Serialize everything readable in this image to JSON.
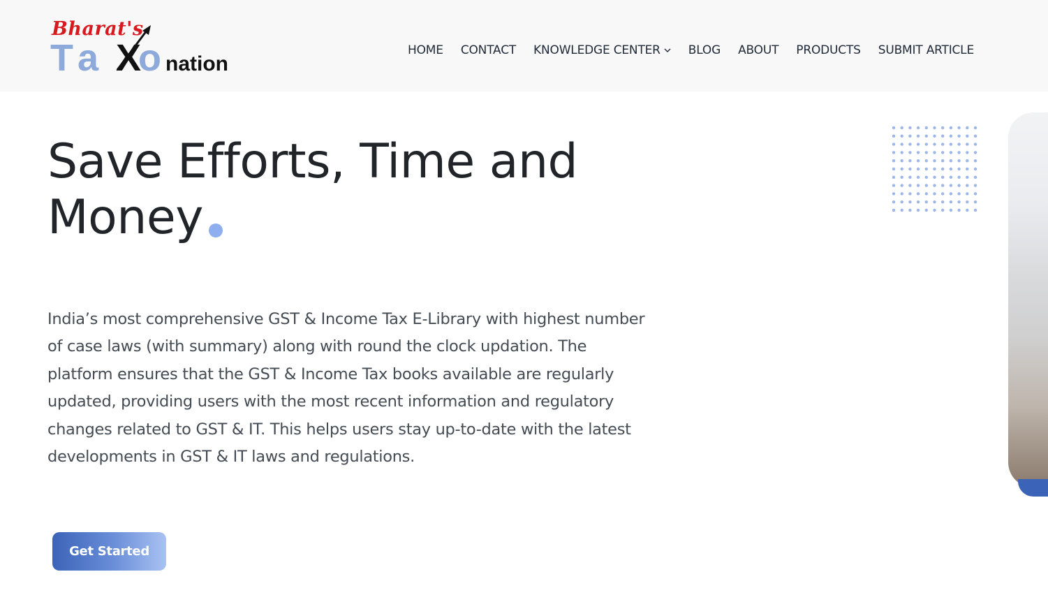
{
  "header": {
    "logo": {
      "script_text": "Bharat's",
      "ta_text": "Ta",
      "x_text": "X",
      "o_text": "o",
      "nation_text": "nation"
    },
    "nav": [
      {
        "label": "HOME"
      },
      {
        "label": "CONTACT"
      },
      {
        "label": "KNOWLEDGE CENTER",
        "has_dropdown": true
      },
      {
        "label": "BLOG"
      },
      {
        "label": "ABOUT"
      },
      {
        "label": "PRODUCTS"
      },
      {
        "label": "SUBMIT ARTICLE"
      }
    ]
  },
  "hero": {
    "title_line1": "Save Efforts, Time and",
    "title_line2": "Money",
    "description": "India’s most comprehensive GST & Income Tax E-Library with highest number of case laws (with summary) along with round the clock updation. The platform ensures that the GST & Income Tax books available are regularly updated, providing users with the most recent information and regulatory changes related to GST & IT. This helps users stay up-to-date with the latest developments in GST & IT laws and regulations.",
    "cta_label": "Get Started"
  },
  "colors": {
    "header_bg": "#f8f8f8",
    "accent_blue": "#3b63b8",
    "dot_blue": "#8eaef0",
    "logo_red": "#d71920"
  }
}
